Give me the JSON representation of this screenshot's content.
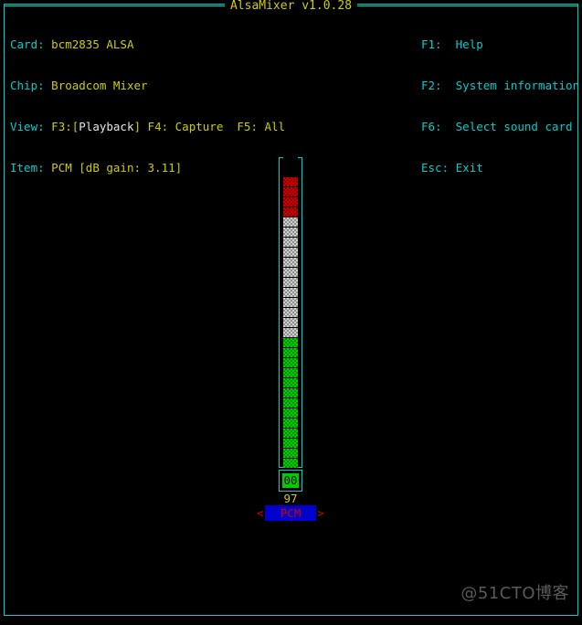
{
  "window": {
    "title": "AlsaMixer v1.0.28",
    "border_color": "#00cdcd",
    "background": "#000000"
  },
  "header": {
    "left": [
      {
        "label": "Card:",
        "value": "bcm2835 ALSA"
      },
      {
        "label": "Chip:",
        "value": "Broadcom Mixer"
      },
      {
        "label": "View:",
        "value_prefix": "F3:",
        "selected_open": "[",
        "selected": "Playback",
        "selected_close": "]",
        "value_suffix": " F4: Capture  F5: All"
      },
      {
        "label": "Item:",
        "value": "PCM [dB gain: 3.11]"
      }
    ],
    "right": [
      {
        "key": "F1:",
        "action": "Help"
      },
      {
        "key": "F2:",
        "action": "System information"
      },
      {
        "key": "F6:",
        "action": "Select sound card"
      },
      {
        "key": "Esc:",
        "action": "Exit"
      }
    ]
  },
  "mixer": {
    "channel_name": "PCM",
    "left_arrow": "<",
    "right_arrow": ">",
    "volume_percent": "97",
    "mute_readout": "00",
    "bar": {
      "total_blocks": 31,
      "green_blocks": 13,
      "white_blocks": 12,
      "red_blocks": 4,
      "empty_blocks": 2,
      "green_color": "#00cd00",
      "white_color": "#cdcdcd",
      "red_color": "#cd0000"
    }
  },
  "watermark": {
    "text": "@51CTO博客"
  }
}
